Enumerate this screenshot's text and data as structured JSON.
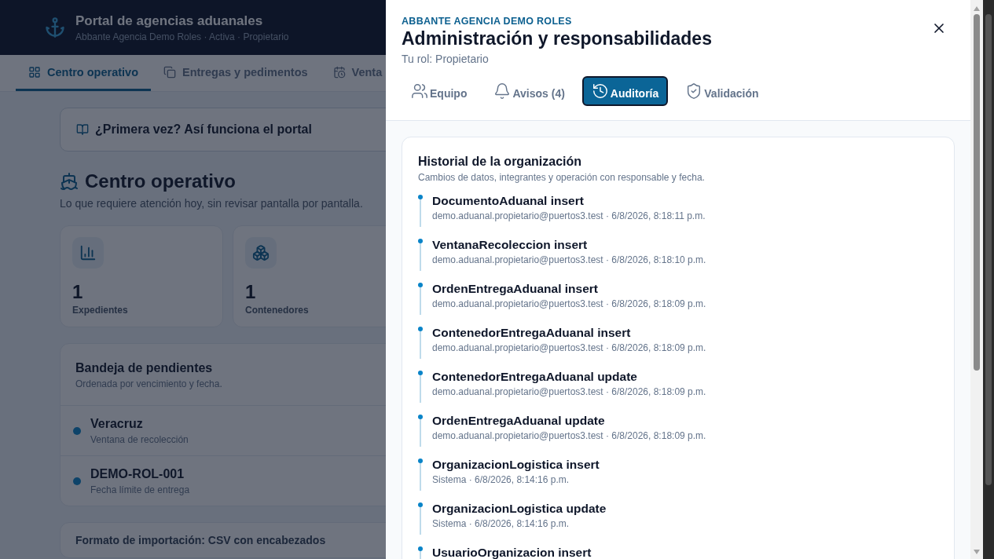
{
  "app": {
    "title": "Portal de agencias aduanales",
    "subtitle": "Abbante Agencia Demo Roles · Activa · Propietario"
  },
  "nav_tabs": [
    {
      "label": "Centro operativo",
      "selected": true
    },
    {
      "label": "Entregas y pedimentos",
      "selected": false
    },
    {
      "label": "Venta",
      "selected": false
    }
  ],
  "guide_banner": {
    "label": "¿Primera vez? Así funciona el portal"
  },
  "page": {
    "title": "Centro operativo",
    "subtitle": "Lo que requiere atención hoy, sin revisar pantalla por pantalla."
  },
  "stats": [
    {
      "value": "1",
      "label": "Expedientes"
    },
    {
      "value": "1",
      "label": "Contenedores"
    }
  ],
  "pending": {
    "title": "Bandeja de pendientes",
    "subtitle": "Ordenada por vencimiento y fecha.",
    "items": [
      {
        "title": "Veracruz",
        "subtitle": "Ventana de recolección"
      },
      {
        "title": "DEMO-ROL-001",
        "subtitle": "Fecha límite de entrega"
      }
    ]
  },
  "next_card": {
    "title": "Formato de importación: CSV con encabezados"
  },
  "drawer": {
    "eyebrow": "ABBANTE AGENCIA DEMO ROLES",
    "title": "Administración y responsabilidades",
    "role": "Tu rol: Propietario",
    "tabs": [
      {
        "label": "Equipo",
        "selected": false
      },
      {
        "label": "Avisos (4)",
        "selected": false
      },
      {
        "label": "Auditoría",
        "selected": true
      },
      {
        "label": "Validación",
        "selected": false
      }
    ],
    "history": {
      "title": "Historial de la organización",
      "subtitle": "Cambios de datos, integrantes y operación con responsable y fecha.",
      "entries": [
        {
          "title": "DocumentoAduanal insert",
          "meta": "demo.aduanal.propietario@puertos3.test · 6/8/2026, 8:18:11 p.m."
        },
        {
          "title": "VentanaRecoleccion insert",
          "meta": "demo.aduanal.propietario@puertos3.test · 6/8/2026, 8:18:10 p.m."
        },
        {
          "title": "OrdenEntregaAduanal insert",
          "meta": "demo.aduanal.propietario@puertos3.test · 6/8/2026, 8:18:09 p.m."
        },
        {
          "title": "ContenedorEntregaAduanal insert",
          "meta": "demo.aduanal.propietario@puertos3.test · 6/8/2026, 8:18:09 p.m."
        },
        {
          "title": "ContenedorEntregaAduanal update",
          "meta": "demo.aduanal.propietario@puertos3.test · 6/8/2026, 8:18:09 p.m."
        },
        {
          "title": "OrdenEntregaAduanal update",
          "meta": "demo.aduanal.propietario@puertos3.test · 6/8/2026, 8:18:09 p.m."
        },
        {
          "title": "OrganizacionLogistica insert",
          "meta": "Sistema · 6/8/2026, 8:14:16 p.m."
        },
        {
          "title": "OrganizacionLogistica update",
          "meta": "Sistema · 6/8/2026, 8:14:16 p.m."
        },
        {
          "title": "UsuarioOrganizacion insert"
        }
      ]
    }
  }
}
